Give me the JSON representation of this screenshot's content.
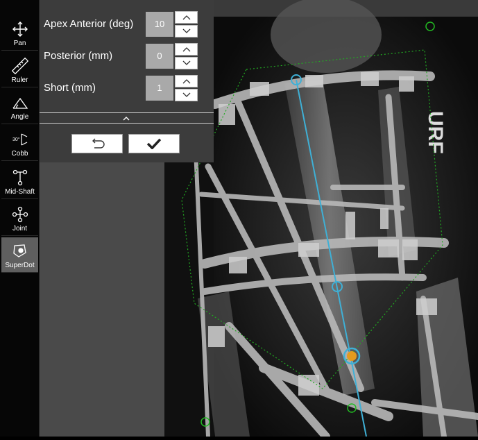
{
  "toolbar": {
    "tools": [
      {
        "label": "Pan",
        "icon": "pan-icon"
      },
      {
        "label": "Ruler",
        "icon": "ruler-icon"
      },
      {
        "label": "Angle",
        "icon": "angle-icon"
      },
      {
        "label": "Cobb",
        "icon": "cobb-icon",
        "glyph": "30°"
      },
      {
        "label": "Mid-Shaft",
        "icon": "mid-shaft-icon"
      },
      {
        "label": "Joint",
        "icon": "joint-icon"
      },
      {
        "label": "SuperDot",
        "icon": "superdot-icon",
        "active": true
      }
    ]
  },
  "params": {
    "apex_anterior": {
      "label": "Apex Anterior (deg)",
      "value": "10"
    },
    "posterior": {
      "label": "Posterior (mm)",
      "value": "0"
    },
    "short": {
      "label": "Short (mm)",
      "value": "1"
    }
  },
  "actions": {
    "undo_icon": "undo-icon",
    "confirm_icon": "checkmark-icon"
  },
  "image": {
    "side_marker": "URF"
  },
  "colors": {
    "panel_bg": "#3c3c3c",
    "toolbar_bg": "#060606",
    "axis_line": "#3fb0d6",
    "polygon_outline": "#22aa22",
    "superdot_fill": "#e39a1f",
    "active_tool_bg": "#5f5f5f"
  }
}
